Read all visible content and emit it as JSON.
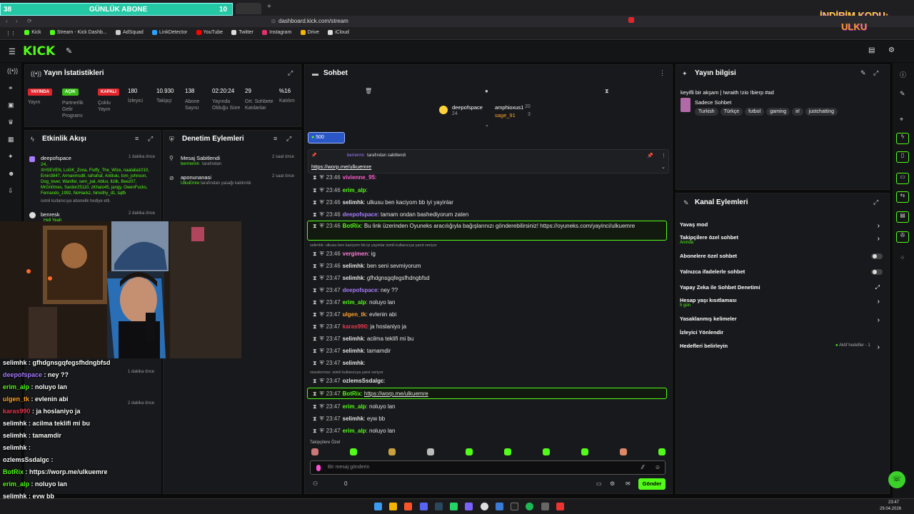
{
  "overlay": {
    "sub_count_left": "38",
    "sub_title": "GÜNLÜK ABONE",
    "sub_count_right": "10",
    "promo_line1": "İNDİRİM KODU:",
    "promo_line2": "ULKU"
  },
  "browser": {
    "url": "dashboard.kick.com/stream",
    "bookmarks": [
      "Kick",
      "Stream - Kick Dashb...",
      "AdSquad",
      "LinkDetector",
      "YouTube",
      "Twitter",
      "Instagram",
      "Drive",
      "iCloud"
    ]
  },
  "header": {
    "logo": "KICK"
  },
  "stats": {
    "title": "Yayın İstatistikleri",
    "badges": [
      {
        "badge": "YAYINDA",
        "label": "Yayın",
        "color": "#e0262c"
      },
      {
        "badge": "AÇIK",
        "label": "Partnerlik Gelir Programı",
        "color": "#3bbd1a"
      },
      {
        "badge": "KAPALI",
        "label": "Çoklu Yayın",
        "color": "#e0262c"
      }
    ],
    "items": [
      {
        "value": "180",
        "label": "İzleyici"
      },
      {
        "value": "10.930",
        "label": "Takipçi"
      },
      {
        "value": "138",
        "label": "Abone Sayısı"
      },
      {
        "value": "02:20:24",
        "label": "Yayında Olduğu Süre"
      },
      {
        "value": "29",
        "label": "Ort. Sohbete Katılanlar"
      },
      {
        "value": "%16",
        "label": "Katılım"
      }
    ]
  },
  "activity": {
    "title": "Etkinlik Akışı",
    "entry1_user": "deepofspace",
    "entry1_time": "1 dakika önce",
    "entry1_count": "24,",
    "entry1_names": "XHSEVEN, LoGK_Zona, Fluffy_The_Wize, naatalia1010, Emin3847, Armanmsd8, rafrafraf, Antilulu, tom_johnson, Dog_lover, Wanifer, sem_pal, Abluv, Ilzilk, Beez07, MrGn0mes, Sardor25110, zKhalo45, jangy, OwenFucks, Fernando_1992, NoHackz, himothy_d1, tajfb",
    "entry1_suffix": "isimli kullanıcıya abonelik hediye etti.",
    "entry2_user": "benresk",
    "entry2_time": "2 dakika önce",
    "entry2_msg": "Hell Yeah"
  },
  "moderation": {
    "title": "Denetim Eylemleri",
    "a1_title": "Mesaj Sabitlendi",
    "a1_user": "berrrennn",
    "a1_suffix": "tarafından",
    "a1_time": "2 saat önce",
    "a2_title": "aponunanasi",
    "a2_user": "UlkuEmre",
    "a2_suffix": "tarafından yasağı kaldırıldı",
    "a2_time": "2 saat önce"
  },
  "chat": {
    "title": "Sohbet",
    "top_gifter1": "deepofspace",
    "top_gifter1_count": "24",
    "top_gifter2": "amphioxus1",
    "top_gifter2_count": "20",
    "top_gifter3": "sage_91",
    "top_gifter3_count": "3",
    "kicks": "500",
    "pinned_by": "berrennn",
    "pinned_suffix": "tarafından sabitlendi",
    "pinned_link": "https://worp.me/ulkuemre",
    "messages": [
      {
        "time": "23:46",
        "user": "vivienne_95",
        "text": "",
        "color": "#ff5fd2"
      },
      {
        "time": "23:46",
        "user": "erim_alp",
        "text": "",
        "color": "#53fc18"
      },
      {
        "time": "23:46",
        "user": "selimhk",
        "text": "ulkusu ben kaciyom bb iyi yayinlar",
        "color": "#e6e6e6"
      },
      {
        "time": "23:46",
        "user": "deepofspace",
        "text": "tamam ondan bashediyorum zaten",
        "color": "#a77cff"
      },
      {
        "time": "23:46",
        "user": "BotRix",
        "text": "Bu link üzerinden Oyuneks aracılığıyla bağışlarınızı gönderebilirsiniz! https://oyuneks.com/yayinci/ulkuemre",
        "color": "#53fc18"
      },
      {
        "time": "23:46",
        "user": "vergimen",
        "text": "ig",
        "color": "#ff7ad9"
      },
      {
        "time": "23:46",
        "user": "selimhk",
        "text": "ben seni sevmiyorum",
        "color": "#e6e6e6"
      },
      {
        "time": "23:47",
        "user": "selimhk",
        "text": "gfhdgnsgqfegsfhdngbfsd",
        "color": "#e6e6e6"
      },
      {
        "time": "23:47",
        "user": "deepofspace",
        "text": "ney ??",
        "color": "#a77cff"
      },
      {
        "time": "23:47",
        "user": "erim_alp",
        "text": "noluyo lan",
        "color": "#53fc18"
      },
      {
        "time": "23:47",
        "user": "ulgen_tk",
        "text": "evlenin abi",
        "color": "#ffa42f"
      },
      {
        "time": "23:47",
        "user": "karas990",
        "text": "ja hoslaniyo ja",
        "color": "#e83a52"
      },
      {
        "time": "23:47",
        "user": "selimhk",
        "text": "acilma teklifi mi bu",
        "color": "#e6e6e6"
      },
      {
        "time": "23:47",
        "user": "selimhk",
        "text": "tamamdir",
        "color": "#e6e6e6"
      },
      {
        "time": "23:47",
        "user": "selimhk",
        "text": "",
        "color": "#e6e6e6"
      },
      {
        "time": "23:47",
        "user": "ozlemsSsdalgc",
        "text": "",
        "color": "#e6e6e6"
      },
      {
        "time": "23:47",
        "user": "BotRix",
        "text": "https://worp.me/ulkuemre",
        "color": "#53fc18"
      },
      {
        "time": "23:47",
        "user": "erim_alp",
        "text": "noluyo lan",
        "color": "#53fc18"
      },
      {
        "time": "23:47",
        "user": "selimhk",
        "text": "eyw bb",
        "color": "#e6e6e6"
      },
      {
        "time": "23:47",
        "user": "erim_alp",
        "text": "noluyo lan",
        "color": "#53fc18"
      }
    ],
    "reply1": "selimhk: ulkusu ben kaciyom bb iyi yayinlar isimli kullanıcıya yanıt veriyor",
    "reply2": "nisedorross: isimli kullanıcıya yanıt veriyor",
    "followers_only": "Takipçilere Özel",
    "input_placeholder": "Bir mesaj gönderin",
    "points": "0",
    "send": "Gönder"
  },
  "stream_info": {
    "title": "Yayın bilgisi",
    "stream_title": "keyifli bir akşam | !wraith !zio !bierp #ad",
    "category": "Sadece Sohbet",
    "tags": [
      "Turkish",
      "Türkçe",
      "futbol",
      "gaming",
      "irl",
      "justchatting"
    ]
  },
  "channel_actions": {
    "title": "Kanal Eylemleri",
    "items": [
      {
        "label": "Yavaş mod",
        "sub": "",
        "kind": "arrow"
      },
      {
        "label": "Takipçilere özel sohbet",
        "sub": "Anında",
        "kind": "arrow"
      },
      {
        "label": "Abonelere özel sohbet",
        "sub": "",
        "kind": "toggle"
      },
      {
        "label": "Yalnızca ifadelerle sohbet",
        "sub": "",
        "kind": "toggle"
      },
      {
        "label": "Yapay Zeka ile Sohbet Denetimi",
        "sub": "",
        "kind": "ext"
      },
      {
        "label": "Hesap yaşı kısıtlaması",
        "sub": "5 gün",
        "kind": "arrow"
      },
      {
        "label": "Yasaklanmış kelimeler",
        "sub": "",
        "kind": "arrow"
      },
      {
        "label": "İzleyici Yönlendir",
        "sub": "",
        "kind": "none"
      },
      {
        "label": "Hedefleri belirleyin",
        "sub": "",
        "kind": "arrow"
      }
    ],
    "goals_badge": "Aktif hedefler - 1"
  },
  "stream_overlay_chat": [
    {
      "user": "selimhk",
      "text": "gfhdgnsgqfegsfhdngbfsd",
      "color": "#ffffff"
    },
    {
      "user": "deepofspace",
      "text": "ney ??",
      "color": "#a77cff"
    },
    {
      "user": "erim_alp",
      "text": "noluyo lan",
      "color": "#53fc18"
    },
    {
      "user": "ulgen_tk",
      "text": "evlenin abi",
      "color": "#ffa42f"
    },
    {
      "user": "karas990",
      "text": "ja hoslaniyo ja",
      "color": "#e83a52"
    },
    {
      "user": "selimhk",
      "text": "acilma teklifi mi bu",
      "color": "#ffffff"
    },
    {
      "user": "selimhk",
      "text": "tamamdir",
      "color": "#ffffff"
    },
    {
      "user": "selimhk",
      "text": "",
      "color": "#ffffff"
    },
    {
      "user": "ozlemsSsdalgc",
      "text": "",
      "color": "#ffffff"
    },
    {
      "user": "BotRix",
      "text": "https://worp.me/ulkuemre",
      "color": "#53fc18"
    },
    {
      "user": "erim_alp",
      "text": "noluyo lan",
      "color": "#53fc18"
    },
    {
      "user": "selimhk",
      "text": "eyw bb",
      "color": "#ffffff"
    },
    {
      "user": "erim_alp",
      "text": "noluyo lan",
      "color": "#53fc18"
    }
  ],
  "taskbar": {
    "time": "23:47",
    "date": "29.04.2026"
  }
}
